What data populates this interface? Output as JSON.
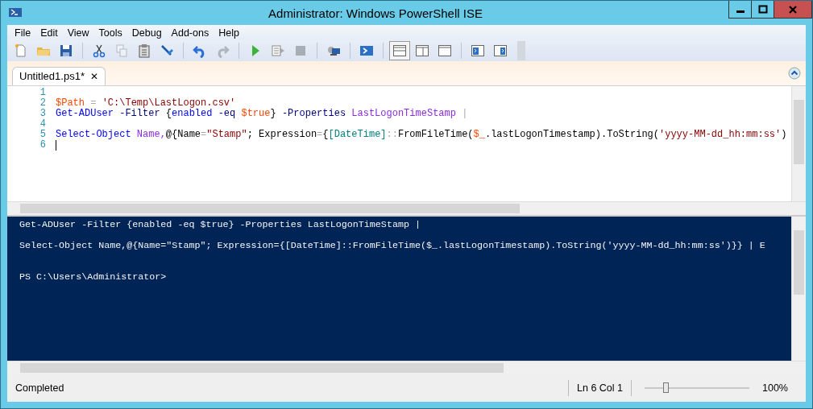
{
  "window": {
    "title": "Administrator: Windows PowerShell ISE"
  },
  "menu": [
    "File",
    "Edit",
    "View",
    "Tools",
    "Debug",
    "Add-ons",
    "Help"
  ],
  "toolbar": [
    {
      "kind": "new",
      "disabled": false
    },
    {
      "kind": "open",
      "disabled": false
    },
    {
      "kind": "save",
      "disabled": false
    },
    {
      "kind": "sep"
    },
    {
      "kind": "cut",
      "disabled": false
    },
    {
      "kind": "copy",
      "disabled": true
    },
    {
      "kind": "paste",
      "disabled": false
    },
    {
      "kind": "clear",
      "disabled": false
    },
    {
      "kind": "sep"
    },
    {
      "kind": "undo",
      "disabled": false
    },
    {
      "kind": "redo",
      "disabled": true
    },
    {
      "kind": "sep"
    },
    {
      "kind": "run",
      "disabled": false
    },
    {
      "kind": "runsel",
      "disabled": false
    },
    {
      "kind": "stop",
      "disabled": true
    },
    {
      "kind": "sep"
    },
    {
      "kind": "remote",
      "disabled": false
    },
    {
      "kind": "sep"
    },
    {
      "kind": "ps",
      "disabled": false
    },
    {
      "kind": "sep"
    },
    {
      "kind": "layout-top",
      "selected": true
    },
    {
      "kind": "layout-right",
      "selected": false
    },
    {
      "kind": "layout-max",
      "selected": false
    },
    {
      "kind": "sep"
    },
    {
      "kind": "show-script",
      "disabled": false
    },
    {
      "kind": "show-console",
      "disabled": false
    }
  ],
  "tabs": [
    {
      "label": "Untitled1.ps1*",
      "close": "✕",
      "selected": true
    }
  ],
  "editor": {
    "lines": [
      {
        "number": "1"
      },
      {
        "number": "2",
        "tokens": [
          {
            "text": "$Path",
            "kind": "variable"
          },
          {
            "text": " = ",
            "kind": "operator"
          },
          {
            "text": "'C:\\Temp\\LastLogon.csv'",
            "kind": "string"
          }
        ]
      },
      {
        "number": "3",
        "tokens": [
          {
            "text": "Get-ADUser",
            "kind": "command"
          },
          {
            "text": " -Filter ",
            "kind": "parameter"
          },
          {
            "text": "{",
            "kind": "plain"
          },
          {
            "text": "enabled",
            "kind": "command"
          },
          {
            "text": " -eq ",
            "kind": "parameter"
          },
          {
            "text": "$true",
            "kind": "variable"
          },
          {
            "text": "}",
            "kind": "plain"
          },
          {
            "text": " -Properties ",
            "kind": "parameter"
          },
          {
            "text": "LastLogonTimeStamp",
            "kind": "argument"
          },
          {
            "text": " |",
            "kind": "operator"
          }
        ]
      },
      {
        "number": "4"
      },
      {
        "number": "5",
        "tokens": [
          {
            "text": "Select-Object",
            "kind": "command"
          },
          {
            "text": " Name,",
            "kind": "argument"
          },
          {
            "text": "@{Name",
            "kind": "plain"
          },
          {
            "text": "=",
            "kind": "operator"
          },
          {
            "text": "\"Stamp\"",
            "kind": "string"
          },
          {
            "text": "; Expression",
            "kind": "plain"
          },
          {
            "text": "=",
            "kind": "operator"
          },
          {
            "text": "{",
            "kind": "plain"
          },
          {
            "text": "[DateTime]",
            "kind": "type"
          },
          {
            "text": "::",
            "kind": "operator"
          },
          {
            "text": "FromFileTime(",
            "kind": "plain"
          },
          {
            "text": "$_",
            "kind": "variable"
          },
          {
            "text": ".lastLogonTimestamp).ToString(",
            "kind": "plain"
          },
          {
            "text": "'yyyy-MM-dd_hh:mm:ss'",
            "kind": "string"
          },
          {
            "text": ")",
            "kind": "plain"
          }
        ]
      },
      {
        "number": "6"
      }
    ]
  },
  "console": {
    "lines": [
      {
        "text": "Get-ADUser -Filter {enabled -eq $true} -Properties LastLogonTimeStamp |"
      },
      {
        "text": "Select-Object Name,@{Name=\"Stamp\"; Expression={[DateTime]::FromFileTime($_.lastLogonTimestamp).ToString('yyyy-MM-dd_hh:mm:ss')}} | E"
      },
      {
        "text": "PS C:\\Users\\Administrator>"
      }
    ]
  },
  "status_bar": {
    "status": "Completed",
    "position": "Ln 6  Col 1",
    "zoom": {
      "level": 0.2,
      "reading": "100%"
    }
  }
}
